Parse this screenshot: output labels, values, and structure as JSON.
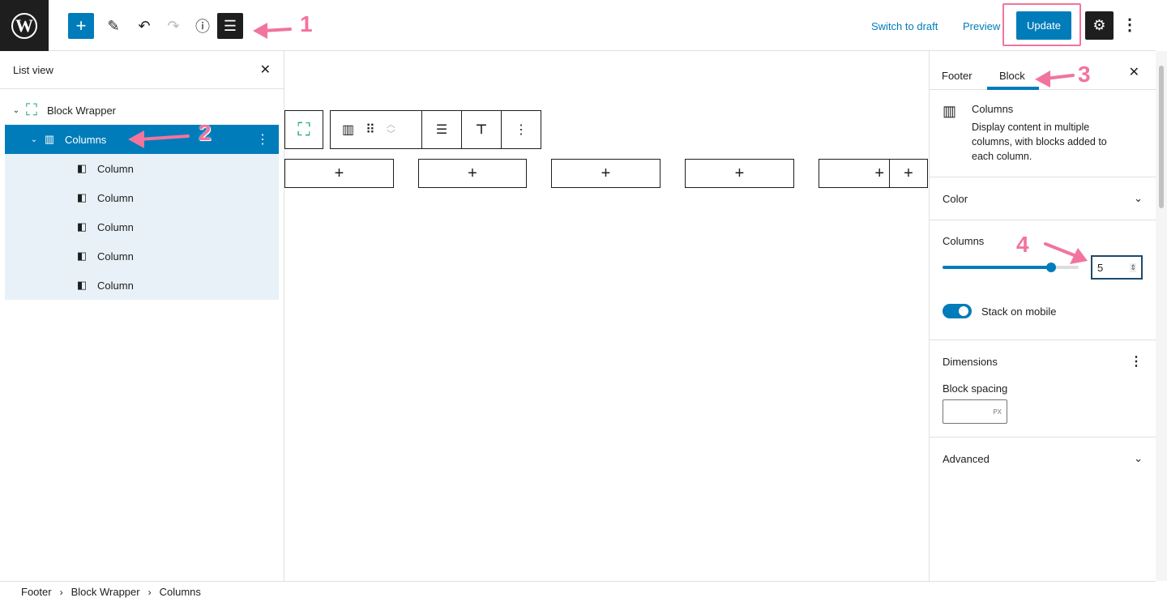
{
  "header": {
    "switch_to_draft": "Switch to draft",
    "preview": "Preview",
    "update": "Update"
  },
  "annotations": {
    "n1": "1",
    "n2": "2",
    "n3": "3",
    "n4": "4",
    "color": "#f2749c"
  },
  "list_view": {
    "title": "List view",
    "items": [
      {
        "label": "Block Wrapper",
        "level": 0
      },
      {
        "label": "Columns",
        "level": 1,
        "selected": true
      },
      {
        "label": "Column"
      },
      {
        "label": "Column"
      },
      {
        "label": "Column"
      },
      {
        "label": "Column"
      },
      {
        "label": "Column"
      }
    ]
  },
  "sidebar": {
    "tabs": [
      "Footer",
      "Block"
    ],
    "active_tab": "Block",
    "block": {
      "name": "Columns",
      "description": "Display content in multiple columns, with blocks added to each column."
    },
    "color_label": "Color",
    "columns_label": "Columns",
    "columns_value": "5",
    "columns_slider_percent": 80,
    "stack_label": "Stack on mobile",
    "stack_on": true,
    "dimensions_label": "Dimensions",
    "block_spacing_label": "Block spacing",
    "unit": "PX",
    "advanced_label": "Advanced"
  },
  "breadcrumb": [
    "Footer",
    "Block Wrapper",
    "Columns"
  ],
  "colors": {
    "accent": "#007cba",
    "dark": "#1e1e1e",
    "selection_bg": "#e8f1f8",
    "group_icon": "#1fa57f"
  }
}
